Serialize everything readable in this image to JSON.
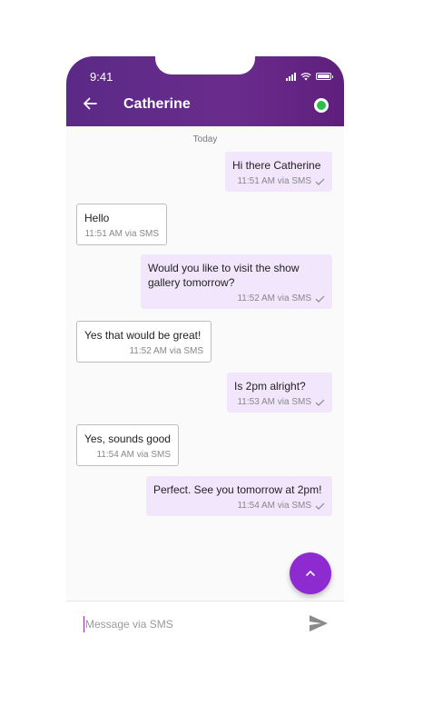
{
  "status_bar": {
    "time": "9:41"
  },
  "header": {
    "contact_name": "Catherine"
  },
  "chat": {
    "day_label": "Today",
    "messages": [
      {
        "direction": "out",
        "text": "Hi there Catherine",
        "meta": "11:51 AM via SMS"
      },
      {
        "direction": "in",
        "text": "Hello",
        "meta": "11:51 AM via SMS"
      },
      {
        "direction": "out",
        "text": "Would you like to visit the show gallery tomorrow?",
        "meta": "11:52 AM via SMS"
      },
      {
        "direction": "in",
        "text": "Yes that would be great!",
        "meta": "11:52 AM via SMS"
      },
      {
        "direction": "out",
        "text": "Is 2pm alright?",
        "meta": "11:53 AM via SMS"
      },
      {
        "direction": "in",
        "text": "Yes, sounds good",
        "meta": "11:54 AM via SMS"
      },
      {
        "direction": "out",
        "text": "Perfect. See you tomorrow at 2pm!",
        "meta": "11:54 AM via SMS"
      }
    ]
  },
  "composer": {
    "placeholder": "Message via SMS"
  },
  "icons": {
    "back": "arrow-left-icon",
    "online": "online-status-icon",
    "scroll_up": "chevron-up-icon",
    "send": "send-icon",
    "delivered": "check-icon"
  },
  "colors": {
    "header": "#6a2c8c",
    "accent": "#8d2bd1",
    "outgoing_bubble": "#f1e6fb",
    "online": "#2ebd4c"
  }
}
